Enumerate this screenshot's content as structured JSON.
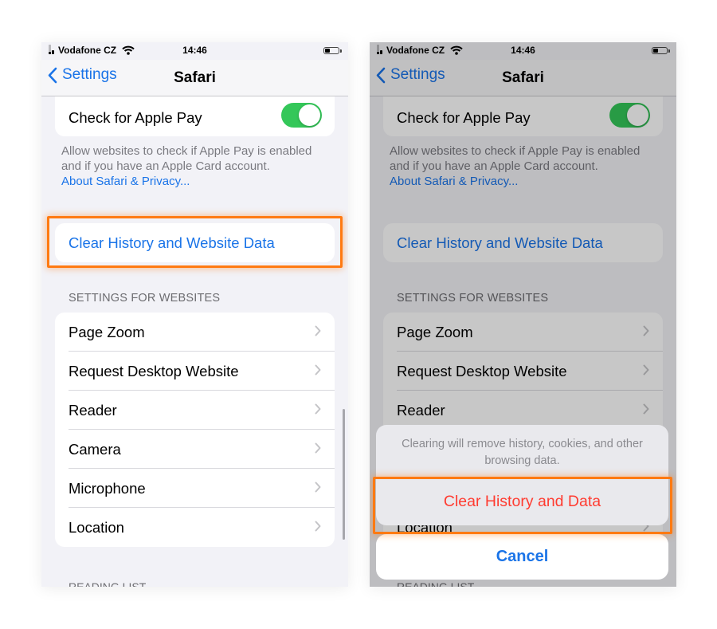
{
  "status_bar": {
    "carrier": "Vodafone CZ",
    "time": "14:46"
  },
  "nav": {
    "back_label": "Settings",
    "title": "Safari"
  },
  "apple_pay": {
    "label": "Check for Apple Pay",
    "enabled": true,
    "footnote_line1": "Allow websites to check if Apple Pay is enabled",
    "footnote_line2": "and if you have an Apple Card account.",
    "link": "About Safari & Privacy..."
  },
  "clear_history": {
    "label": "Clear History and Website Data"
  },
  "settings_for_websites": {
    "header": "SETTINGS FOR WEBSITES",
    "items": [
      "Page Zoom",
      "Request Desktop Website",
      "Reader",
      "Camera",
      "Microphone",
      "Location"
    ]
  },
  "reading_list_header_partial": "READING LIST",
  "action_sheet": {
    "message_line1": "Clearing will remove history, cookies, and other",
    "message_line2": "browsing data.",
    "destructive_label": "Clear History and Data",
    "cancel_label": "Cancel"
  },
  "colors": {
    "accent": "#1a74e8",
    "highlight": "#ff7a12",
    "destructive": "#ff3b30",
    "toggle_on": "#34c759"
  }
}
